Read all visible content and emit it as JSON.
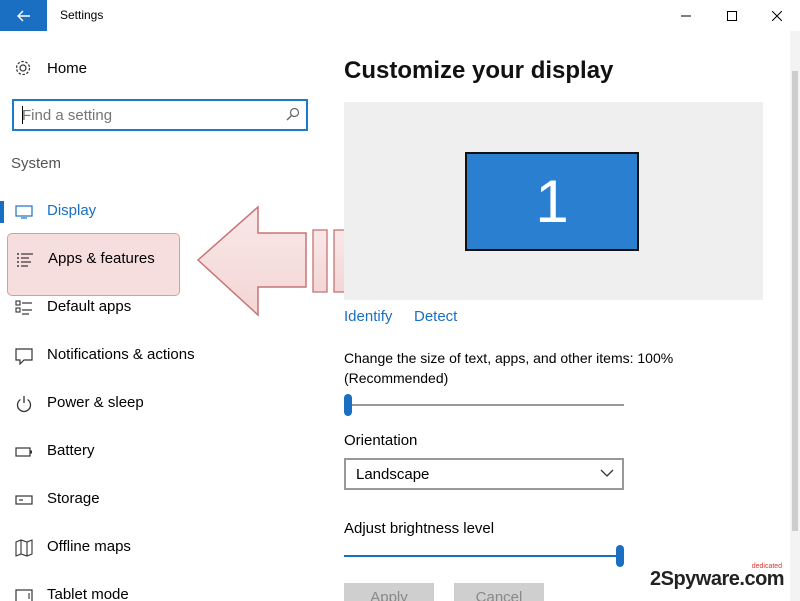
{
  "window": {
    "title": "Settings"
  },
  "sidebar": {
    "home_label": "Home",
    "search_placeholder": "Find a setting",
    "section_label": "System",
    "items": [
      {
        "label": "Display",
        "icon": "monitor-icon",
        "selected": true
      },
      {
        "label": "Apps & features",
        "icon": "list-icon",
        "highlighted": true
      },
      {
        "label": "Default apps",
        "icon": "default-apps-icon"
      },
      {
        "label": "Notifications & actions",
        "icon": "notification-icon"
      },
      {
        "label": "Power & sleep",
        "icon": "power-icon"
      },
      {
        "label": "Battery",
        "icon": "battery-icon"
      },
      {
        "label": "Storage",
        "icon": "storage-icon"
      },
      {
        "label": "Offline maps",
        "icon": "map-icon"
      },
      {
        "label": "Tablet mode",
        "icon": "tablet-icon"
      }
    ]
  },
  "main": {
    "title": "Customize your display",
    "monitor_number": "1",
    "identify_label": "Identify",
    "detect_label": "Detect",
    "scale_label": "Change the size of text, apps, and other items: 100% (Recommended)",
    "scale_value_percent": 0,
    "orientation_label": "Orientation",
    "orientation_value": "Landscape",
    "brightness_label": "Adjust brightness level",
    "brightness_value_percent": 100,
    "apply_label": "Apply",
    "cancel_label": "Cancel"
  },
  "watermark": {
    "text": "2Spyware.com",
    "tag": "dedicated"
  },
  "colors": {
    "accent": "#1b6fc2",
    "highlight": "#f2c8c8",
    "monitor": "#2b7fd0"
  }
}
